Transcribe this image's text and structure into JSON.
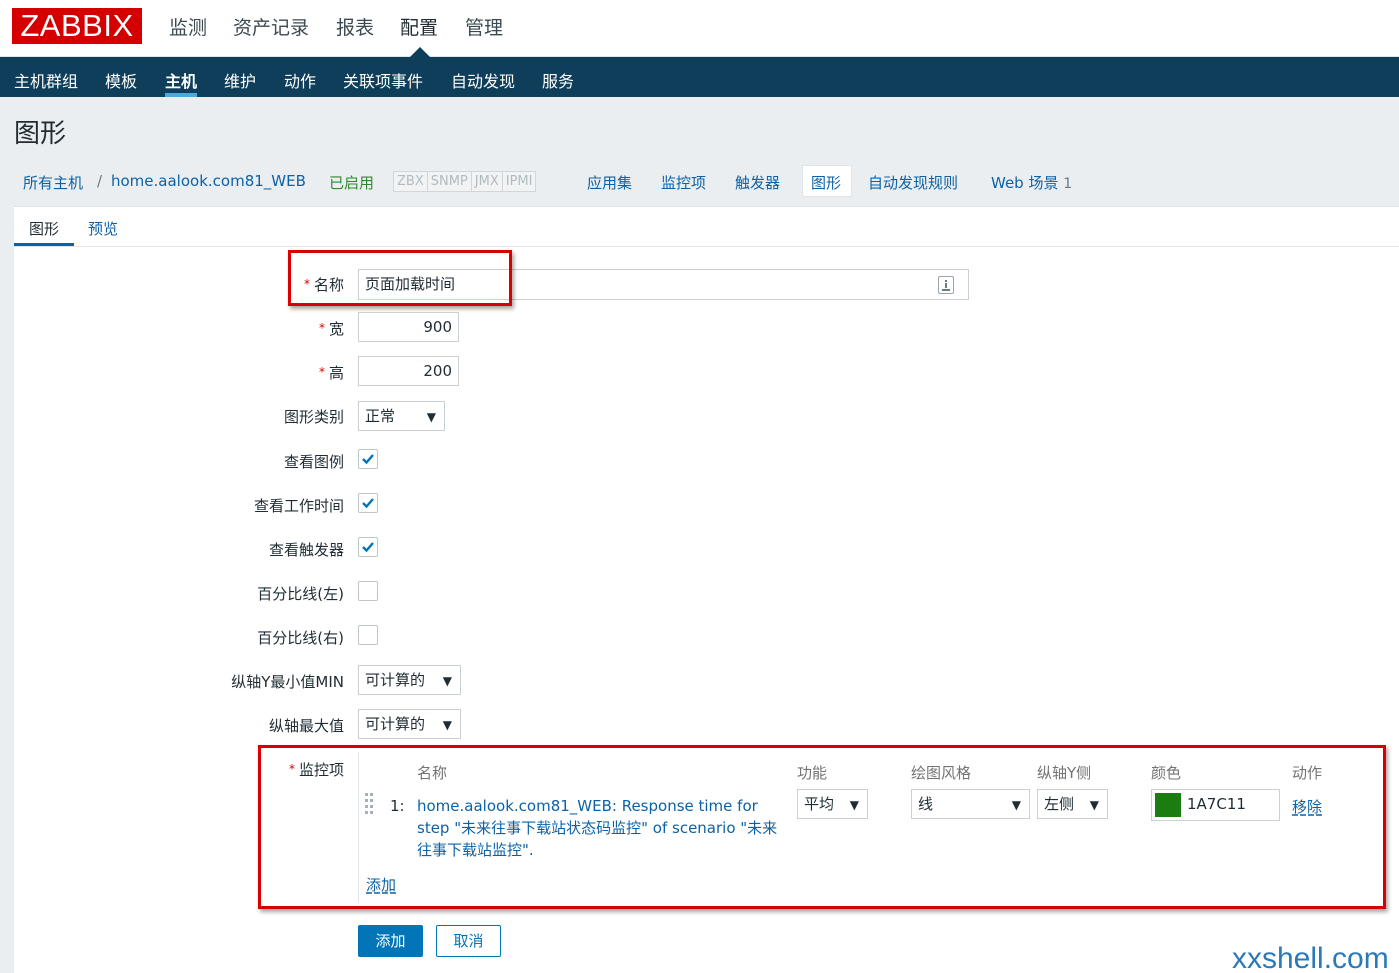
{
  "brand": {
    "logo_text": "ZABBIX",
    "logo_color": "#d40000"
  },
  "top_menu": [
    {
      "label": "监测"
    },
    {
      "label": "资产记录"
    },
    {
      "label": "报表"
    },
    {
      "label": "配置",
      "active": true
    },
    {
      "label": "管理"
    }
  ],
  "sub_menu": [
    {
      "label": "主机群组"
    },
    {
      "label": "模板"
    },
    {
      "label": "主机",
      "active": true
    },
    {
      "label": "维护"
    },
    {
      "label": "动作"
    },
    {
      "label": "关联项事件"
    },
    {
      "label": "自动发现"
    },
    {
      "label": "服务"
    }
  ],
  "page_title": "图形",
  "breadcrumb": {
    "all_hosts": "所有主机",
    "separator": "/",
    "host": "home.aalook.com81_WEB",
    "status": "已启用",
    "availability": [
      "ZBX",
      "SNMP",
      "JMX",
      "IPMI"
    ],
    "links": [
      {
        "label": "应用集"
      },
      {
        "label": "监控项"
      },
      {
        "label": "触发器"
      },
      {
        "label": "图形",
        "active": true
      },
      {
        "label": "自动发现规则"
      },
      {
        "label": "Web 场景",
        "count": "1"
      }
    ]
  },
  "tabs": [
    {
      "label": "图形",
      "active": true
    },
    {
      "label": "预览"
    }
  ],
  "form": {
    "required_mark": "*",
    "name_label": "名称",
    "name_value": "页面加载时间",
    "width_label": "宽",
    "width_value": "900",
    "height_label": "高",
    "height_value": "200",
    "graph_type_label": "图形类别",
    "graph_type_value": "正常",
    "show_legend_label": "查看图例",
    "show_legend": true,
    "show_work_period_label": "查看工作时间",
    "show_work_period": true,
    "show_triggers_label": "查看触发器",
    "show_triggers": true,
    "percentile_left_label": "百分比线(左)",
    "percentile_left": false,
    "percentile_right_label": "百分比线(右)",
    "percentile_right": false,
    "ymin_label": "纵轴Y最小值MIN",
    "ymin_value": "可计算的",
    "ymax_label": "纵轴最大值",
    "ymax_value": "可计算的",
    "items_label": "监控项",
    "items_columns": [
      "名称",
      "功能",
      "绘图风格",
      "纵轴Y侧",
      "颜色",
      "动作"
    ],
    "items": [
      {
        "index": "1:",
        "name": "home.aalook.com81_WEB: Response time for step \"未来往事下载站状态码监控\" of scenario \"未来往事下载站监控\".",
        "function": "平均",
        "draw_style": "线",
        "y_axis_side": "左侧",
        "color": "1A7C11",
        "color_hex": "#1A7C11",
        "action": "移除"
      }
    ],
    "add_item_link": "添加",
    "submit_label": "添加",
    "cancel_label": "取消"
  },
  "dropdown_arrow": "▼",
  "watermark": "xxshell.com"
}
